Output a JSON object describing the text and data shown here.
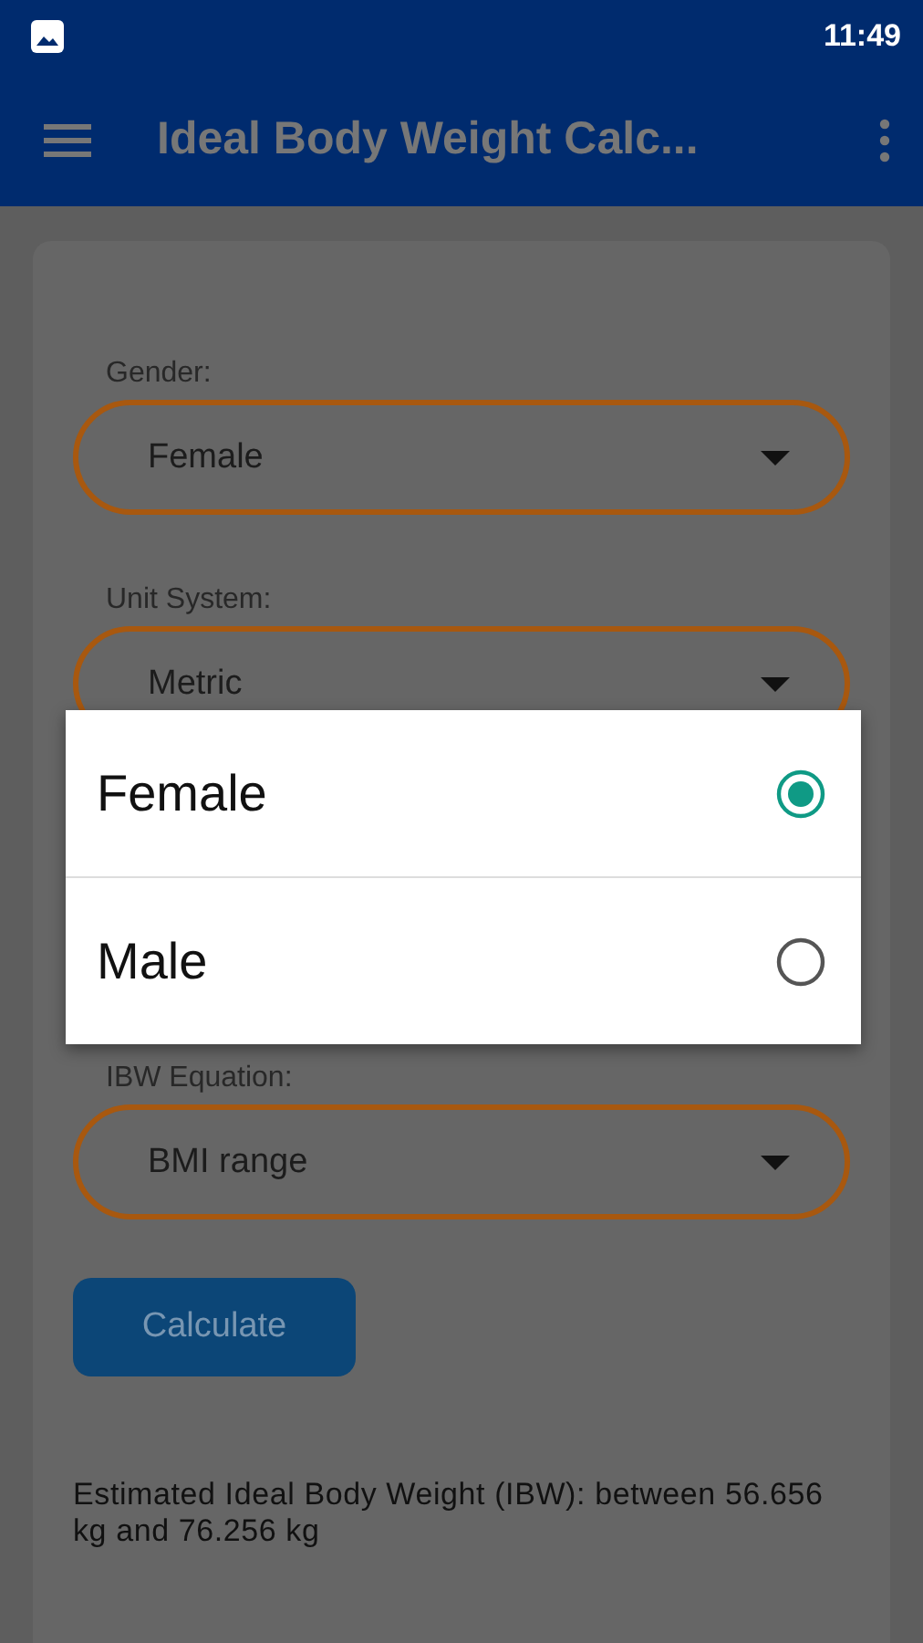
{
  "status_bar": {
    "time": "11:49"
  },
  "app_bar": {
    "title": "Ideal Body Weight Calc..."
  },
  "fields": [
    {
      "label": "Gender:",
      "value": "Female"
    },
    {
      "label": "Unit System:",
      "value": "Metric"
    },
    {
      "label": "IBW Equation:",
      "value": "BMI range"
    }
  ],
  "calculate_button": "Calculate",
  "result": "Estimated Ideal Body Weight (IBW): between 56.656 kg and 76.256 kg",
  "dialog": {
    "options": [
      {
        "label": "Female",
        "selected": true
      },
      {
        "label": "Male",
        "selected": false
      }
    ]
  }
}
